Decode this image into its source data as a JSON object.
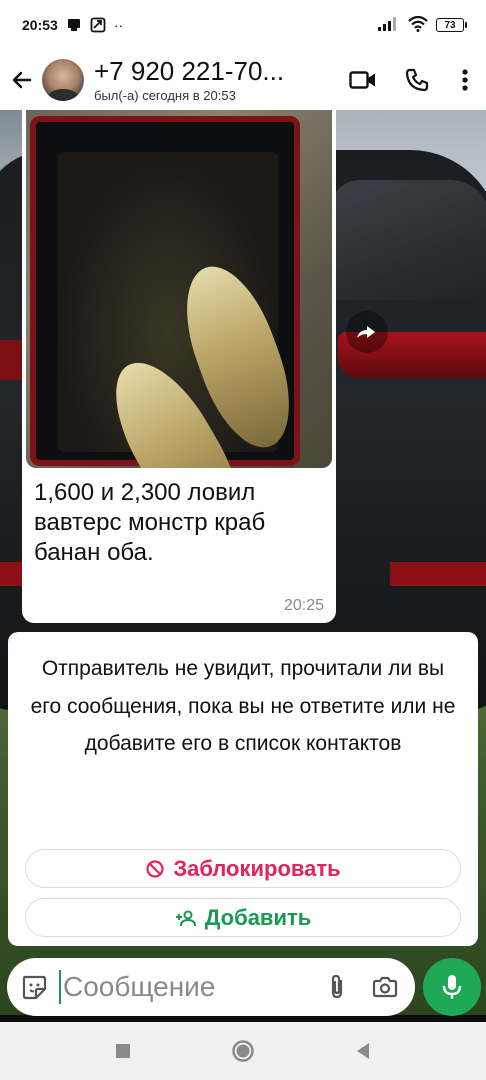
{
  "status_bar": {
    "time": "20:53",
    "battery": "73",
    "dots": "··"
  },
  "header": {
    "contact_name": "+7 920 221-70...",
    "last_seen": "был(-а) сегодня в 20:53",
    "icons": [
      "back-arrow-icon",
      "avatar",
      "video-call-icon",
      "phone-icon",
      "more-vert-icon"
    ]
  },
  "message": {
    "text": "1,600 и 2,300 ловил вавтерс монстр краб банан оба.",
    "time": "20:25",
    "has_photo": true
  },
  "unknown_sender_card": {
    "notice": "Отправитель не увидит, прочитали ли вы его сообщения, пока вы не ответите или не добавите его в список контактов",
    "block_label": "Заблокировать",
    "add_label": "Добавить",
    "block_color": "#e0245e",
    "add_color": "#1a9a51"
  },
  "composer": {
    "placeholder": "Сообщение"
  },
  "colors": {
    "accent": "#1fa855",
    "header_bg": "#ffffff"
  }
}
